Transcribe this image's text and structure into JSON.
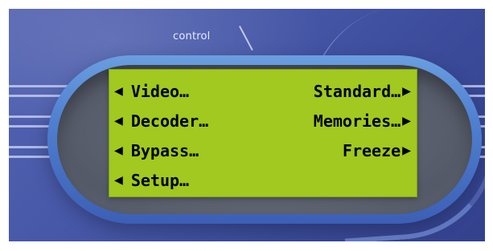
{
  "header": {
    "label": "control"
  },
  "menu": {
    "left_arrow": "◀",
    "right_arrow": "▶",
    "items": [
      {
        "label": "Video…"
      },
      {
        "label": "Standard…"
      },
      {
        "label": "Decoder…"
      },
      {
        "label": "Memories…"
      },
      {
        "label": "Bypass…"
      },
      {
        "label": "Freeze"
      },
      {
        "label": "Setup…"
      }
    ]
  },
  "colors": {
    "lcd_background": "#a1c91f",
    "panel_blue": "#4657a7",
    "text": "#000000"
  },
  "icons": {
    "left": "triangle-left-icon",
    "right": "triangle-right-icon"
  }
}
